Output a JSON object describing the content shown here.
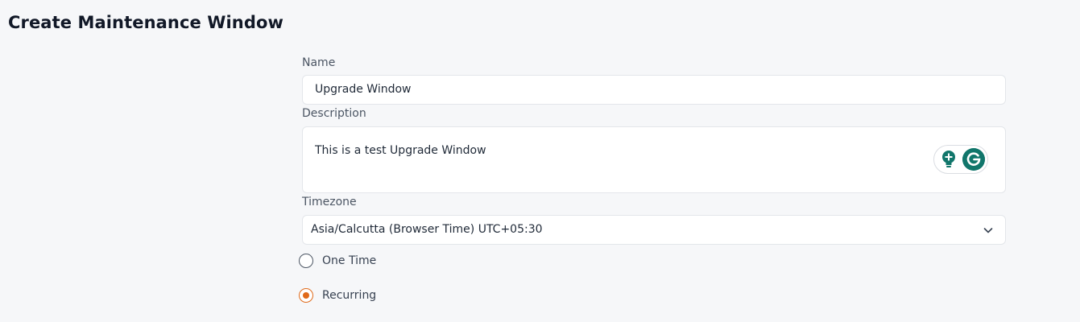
{
  "page": {
    "title": "Create Maintenance Window"
  },
  "form": {
    "name": {
      "label": "Name",
      "value": "Upgrade Window"
    },
    "description": {
      "label": "Description",
      "value": "This is a test Upgrade Window"
    },
    "timezone": {
      "label": "Timezone",
      "selected": "Asia/Calcutta (Browser Time) UTC+05:30"
    },
    "schedule_type": {
      "options": [
        {
          "label": "One Time",
          "selected": false
        },
        {
          "label": "Recurring",
          "selected": true
        }
      ]
    }
  },
  "icons": {
    "grammarly_suggestion": "lightbulb-plus-icon",
    "grammarly": "grammarly-g-icon",
    "select_chevron": "chevron-down-icon"
  },
  "colors": {
    "radio_selected": "#e06a1a",
    "grammarly_green": "#11766b"
  }
}
